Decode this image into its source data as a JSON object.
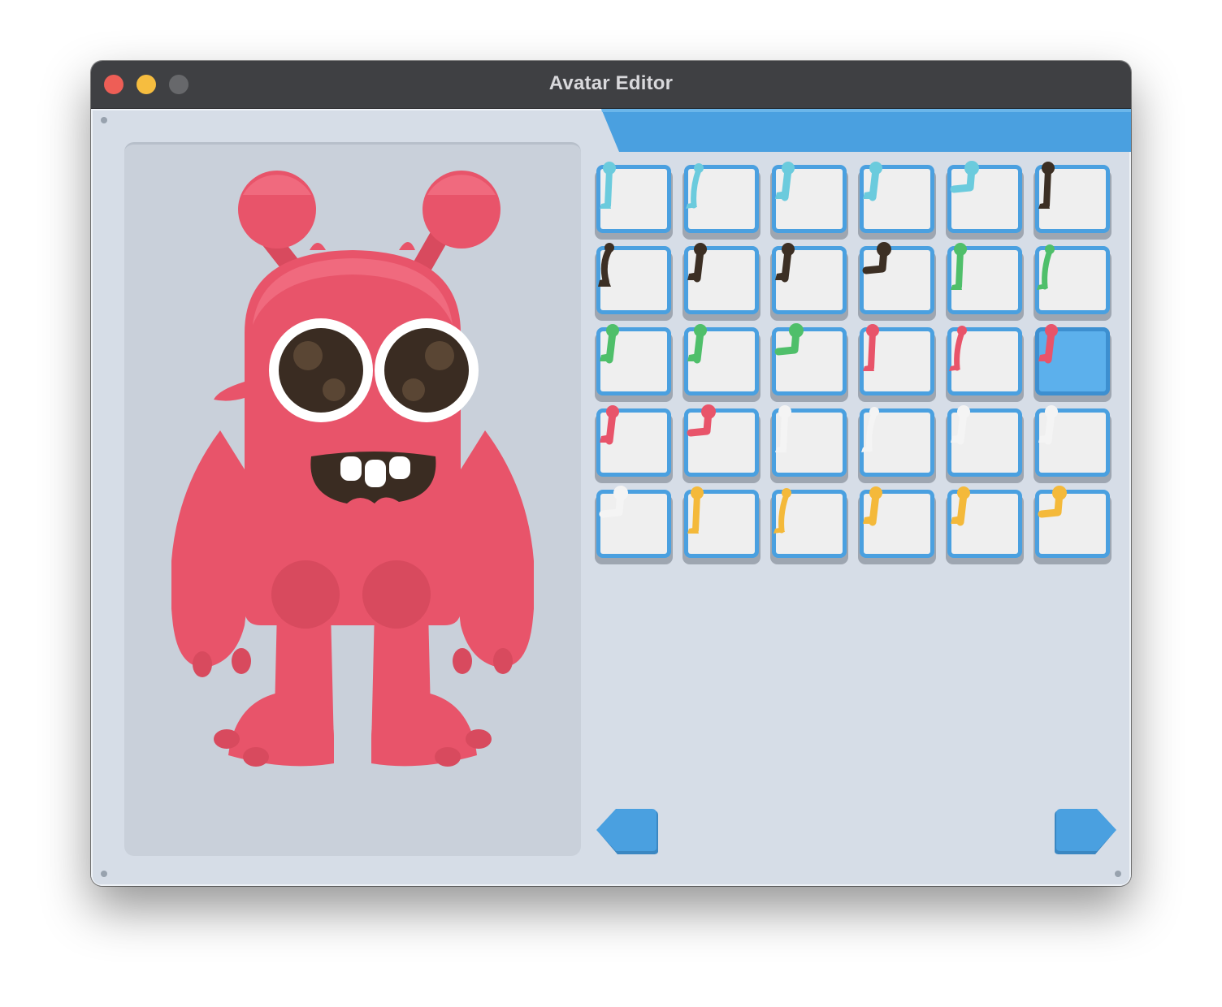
{
  "window": {
    "title": "Avatar Editor"
  },
  "colors": {
    "panel": "#d6dde7",
    "accent_blue": "#4aa0e0",
    "monster_red": "#e8546a",
    "selected_tile": "#5cb0ec"
  },
  "preview": {
    "character": "red-monster",
    "icon": "monster-avatar"
  },
  "leg_options": [
    {
      "color": "#6bcbdd",
      "style": "straight"
    },
    {
      "color": "#6bcbdd",
      "style": "thin"
    },
    {
      "color": "#6bcbdd",
      "style": "short"
    },
    {
      "color": "#6bcbdd",
      "style": "short"
    },
    {
      "color": "#6bcbdd",
      "style": "bent"
    },
    {
      "color": "#3c2f24",
      "style": "straight"
    },
    {
      "color": "#3c2f24",
      "style": "curved"
    },
    {
      "color": "#3c2f24",
      "style": "short"
    },
    {
      "color": "#3c2f24",
      "style": "short"
    },
    {
      "color": "#3c2f24",
      "style": "bent"
    },
    {
      "color": "#4fbf6a",
      "style": "straight"
    },
    {
      "color": "#4fbf6a",
      "style": "thin"
    },
    {
      "color": "#4fbf6a",
      "style": "short"
    },
    {
      "color": "#4fbf6a",
      "style": "short"
    },
    {
      "color": "#4fbf6a",
      "style": "bent"
    },
    {
      "color": "#e8546a",
      "style": "straight"
    },
    {
      "color": "#e8546a",
      "style": "thin"
    },
    {
      "color": "#e8546a",
      "style": "short",
      "selected": true
    },
    {
      "color": "#e8546a",
      "style": "short"
    },
    {
      "color": "#e8546a",
      "style": "bent"
    },
    {
      "color": "#f4f4f4",
      "style": "straight"
    },
    {
      "color": "#f4f4f4",
      "style": "thin"
    },
    {
      "color": "#f4f4f4",
      "style": "short"
    },
    {
      "color": "#f4f4f4",
      "style": "short"
    },
    {
      "color": "#f4f4f4",
      "style": "bent"
    },
    {
      "color": "#f4b93a",
      "style": "straight"
    },
    {
      "color": "#f4b93a",
      "style": "thin"
    },
    {
      "color": "#f4b93a",
      "style": "short"
    },
    {
      "color": "#f4b93a",
      "style": "short"
    },
    {
      "color": "#f4b93a",
      "style": "bent"
    }
  ],
  "navigation": {
    "prev_icon": "arrow-left-icon",
    "next_icon": "arrow-right-icon"
  }
}
